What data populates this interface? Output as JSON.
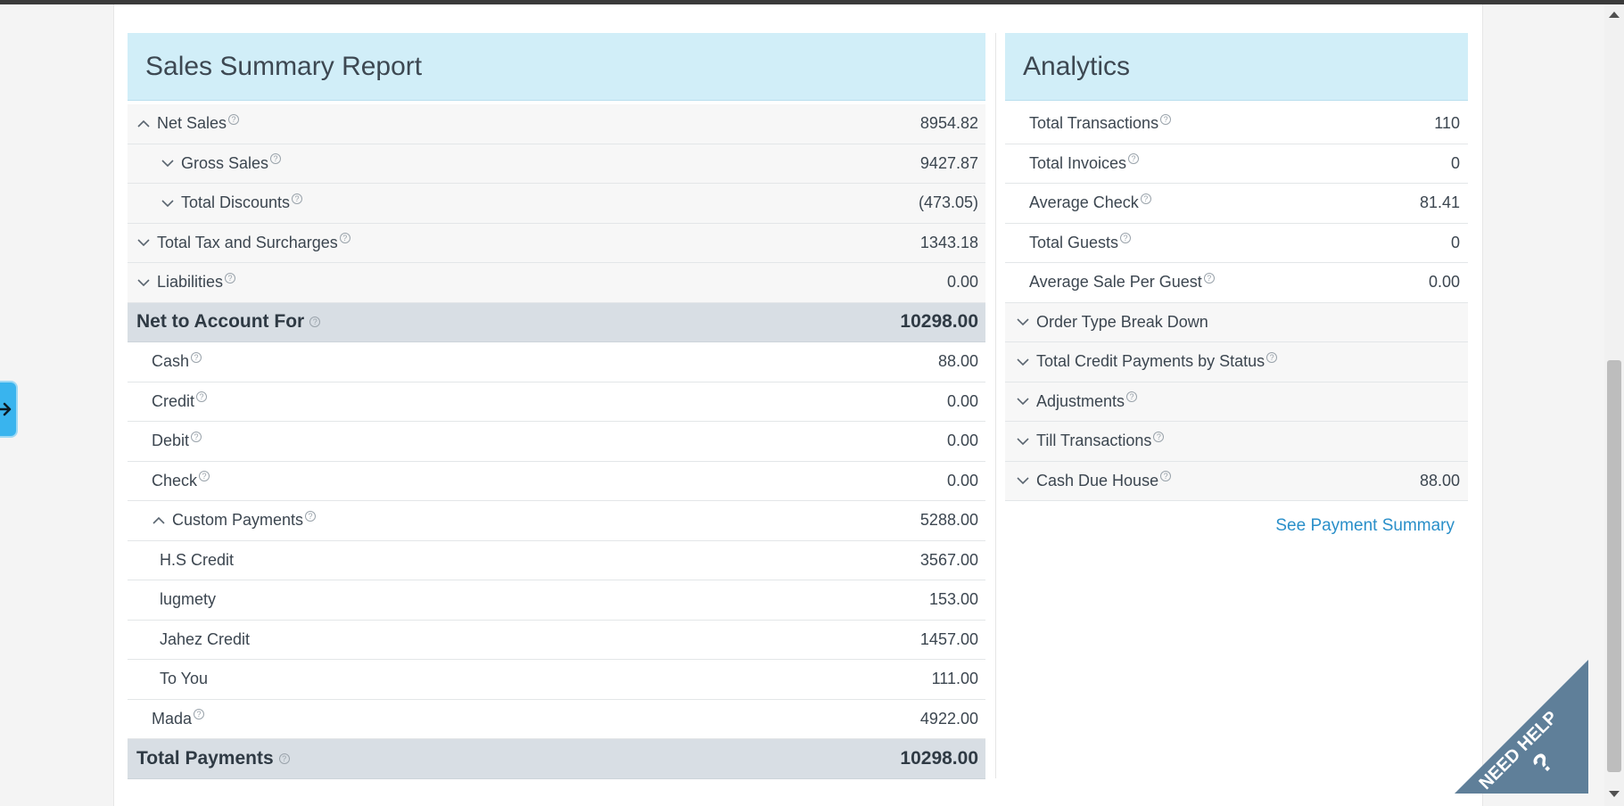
{
  "sales": {
    "title": "Sales Summary Report",
    "rows": [
      {
        "label": "Net Sales",
        "value": "8954.82"
      },
      {
        "label": "Gross Sales",
        "value": "9427.87"
      },
      {
        "label": "Total Discounts",
        "value": "(473.05)"
      },
      {
        "label": "Total Tax and Surcharges",
        "value": "1343.18"
      },
      {
        "label": "Liabilities",
        "value": "0.00"
      }
    ],
    "net_total": {
      "label": "Net to Account For",
      "value": "10298.00"
    },
    "payments": [
      {
        "label": "Cash",
        "value": "88.00"
      },
      {
        "label": "Credit",
        "value": "0.00"
      },
      {
        "label": "Debit",
        "value": "0.00"
      },
      {
        "label": "Check",
        "value": "0.00"
      },
      {
        "label": "Custom Payments",
        "value": "5288.00"
      },
      {
        "label": "H.S Credit",
        "value": "3567.00"
      },
      {
        "label": "lugmety",
        "value": "153.00"
      },
      {
        "label": "Jahez Credit",
        "value": "1457.00"
      },
      {
        "label": "To You",
        "value": "111.00"
      },
      {
        "label": "Mada",
        "value": "4922.00"
      }
    ],
    "payments_total": {
      "label": "Total Payments",
      "value": "10298.00"
    }
  },
  "analytics": {
    "title": "Analytics",
    "rows": [
      {
        "label": "Total Transactions",
        "value": "110"
      },
      {
        "label": "Total Invoices",
        "value": "0"
      },
      {
        "label": "Average Check",
        "value": "81.41"
      },
      {
        "label": "Total Guests",
        "value": "0"
      },
      {
        "label": "Average Sale Per Guest",
        "value": "0.00"
      }
    ],
    "sections": [
      {
        "label": "Order Type Break Down",
        "value": ""
      },
      {
        "label": "Total Credit Payments by Status",
        "value": ""
      },
      {
        "label": "Adjustments",
        "value": ""
      },
      {
        "label": "Till Transactions",
        "value": ""
      },
      {
        "label": "Cash Due House",
        "value": "88.00"
      }
    ],
    "link": "See Payment Summary"
  },
  "help_widget": {
    "line1": "NEED HELP",
    "line2": "?"
  },
  "help_glyph": "?",
  "colors": {
    "header_bg": "#d1eef8",
    "total_bg": "#d8dee4",
    "link": "#2a8fc9",
    "tab": "#39b4ee",
    "help_widget": "#5f7f99"
  },
  "icons": {
    "expand": "chevron-up-icon",
    "collapse": "chevron-down-icon",
    "info": "help-circle-icon",
    "side": "arrow-right-icon"
  }
}
